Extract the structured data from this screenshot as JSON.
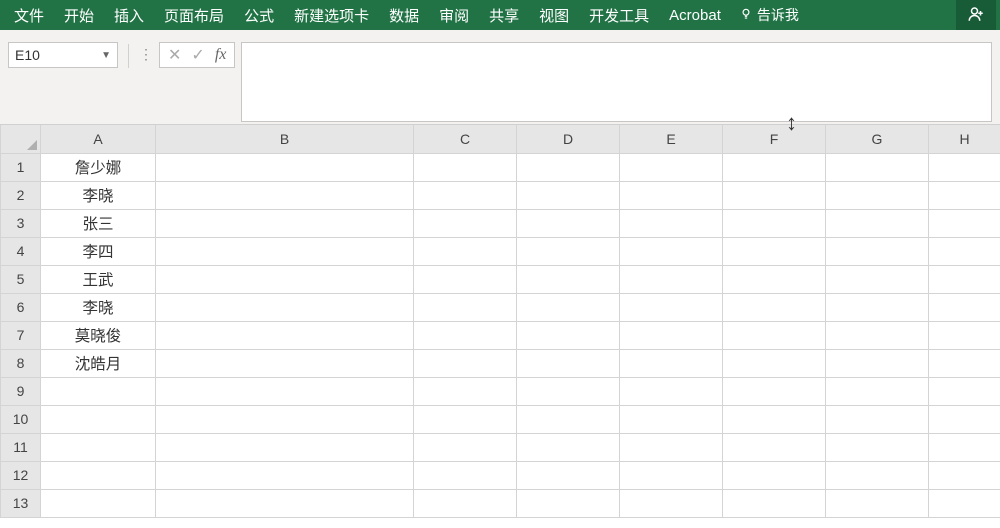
{
  "ribbon": {
    "tabs": [
      "文件",
      "开始",
      "插入",
      "页面布局",
      "公式",
      "新建选项卡",
      "数据",
      "审阅",
      "共享",
      "视图",
      "开发工具",
      "Acrobat"
    ],
    "tell_me": "告诉我"
  },
  "formula_bar": {
    "name_box": "E10",
    "fx_label": "fx",
    "formula_value": ""
  },
  "grid": {
    "columns": [
      "A",
      "B",
      "C",
      "D",
      "E",
      "F",
      "G",
      "H"
    ],
    "rows": [
      {
        "n": "1",
        "cells": [
          "詹少娜",
          "",
          "",
          "",
          "",
          "",
          "",
          ""
        ]
      },
      {
        "n": "2",
        "cells": [
          "李晓",
          "",
          "",
          "",
          "",
          "",
          "",
          ""
        ]
      },
      {
        "n": "3",
        "cells": [
          "张三",
          "",
          "",
          "",
          "",
          "",
          "",
          ""
        ]
      },
      {
        "n": "4",
        "cells": [
          "李四",
          "",
          "",
          "",
          "",
          "",
          "",
          ""
        ]
      },
      {
        "n": "5",
        "cells": [
          "王武",
          "",
          "",
          "",
          "",
          "",
          "",
          ""
        ]
      },
      {
        "n": "6",
        "cells": [
          "李晓",
          "",
          "",
          "",
          "",
          "",
          "",
          ""
        ]
      },
      {
        "n": "7",
        "cells": [
          "莫晓俊",
          "",
          "",
          "",
          "",
          "",
          "",
          ""
        ]
      },
      {
        "n": "8",
        "cells": [
          "沈皓月",
          "",
          "",
          "",
          "",
          "",
          "",
          ""
        ]
      },
      {
        "n": "9",
        "cells": [
          "",
          "",
          "",
          "",
          "",
          "",
          "",
          ""
        ]
      },
      {
        "n": "10",
        "cells": [
          "",
          "",
          "",
          "",
          "",
          "",
          "",
          ""
        ]
      },
      {
        "n": "11",
        "cells": [
          "",
          "",
          "",
          "",
          "",
          "",
          "",
          ""
        ]
      },
      {
        "n": "12",
        "cells": [
          "",
          "",
          "",
          "",
          "",
          "",
          "",
          ""
        ]
      },
      {
        "n": "13",
        "cells": [
          "",
          "",
          "",
          "",
          "",
          "",
          "",
          ""
        ]
      }
    ]
  }
}
